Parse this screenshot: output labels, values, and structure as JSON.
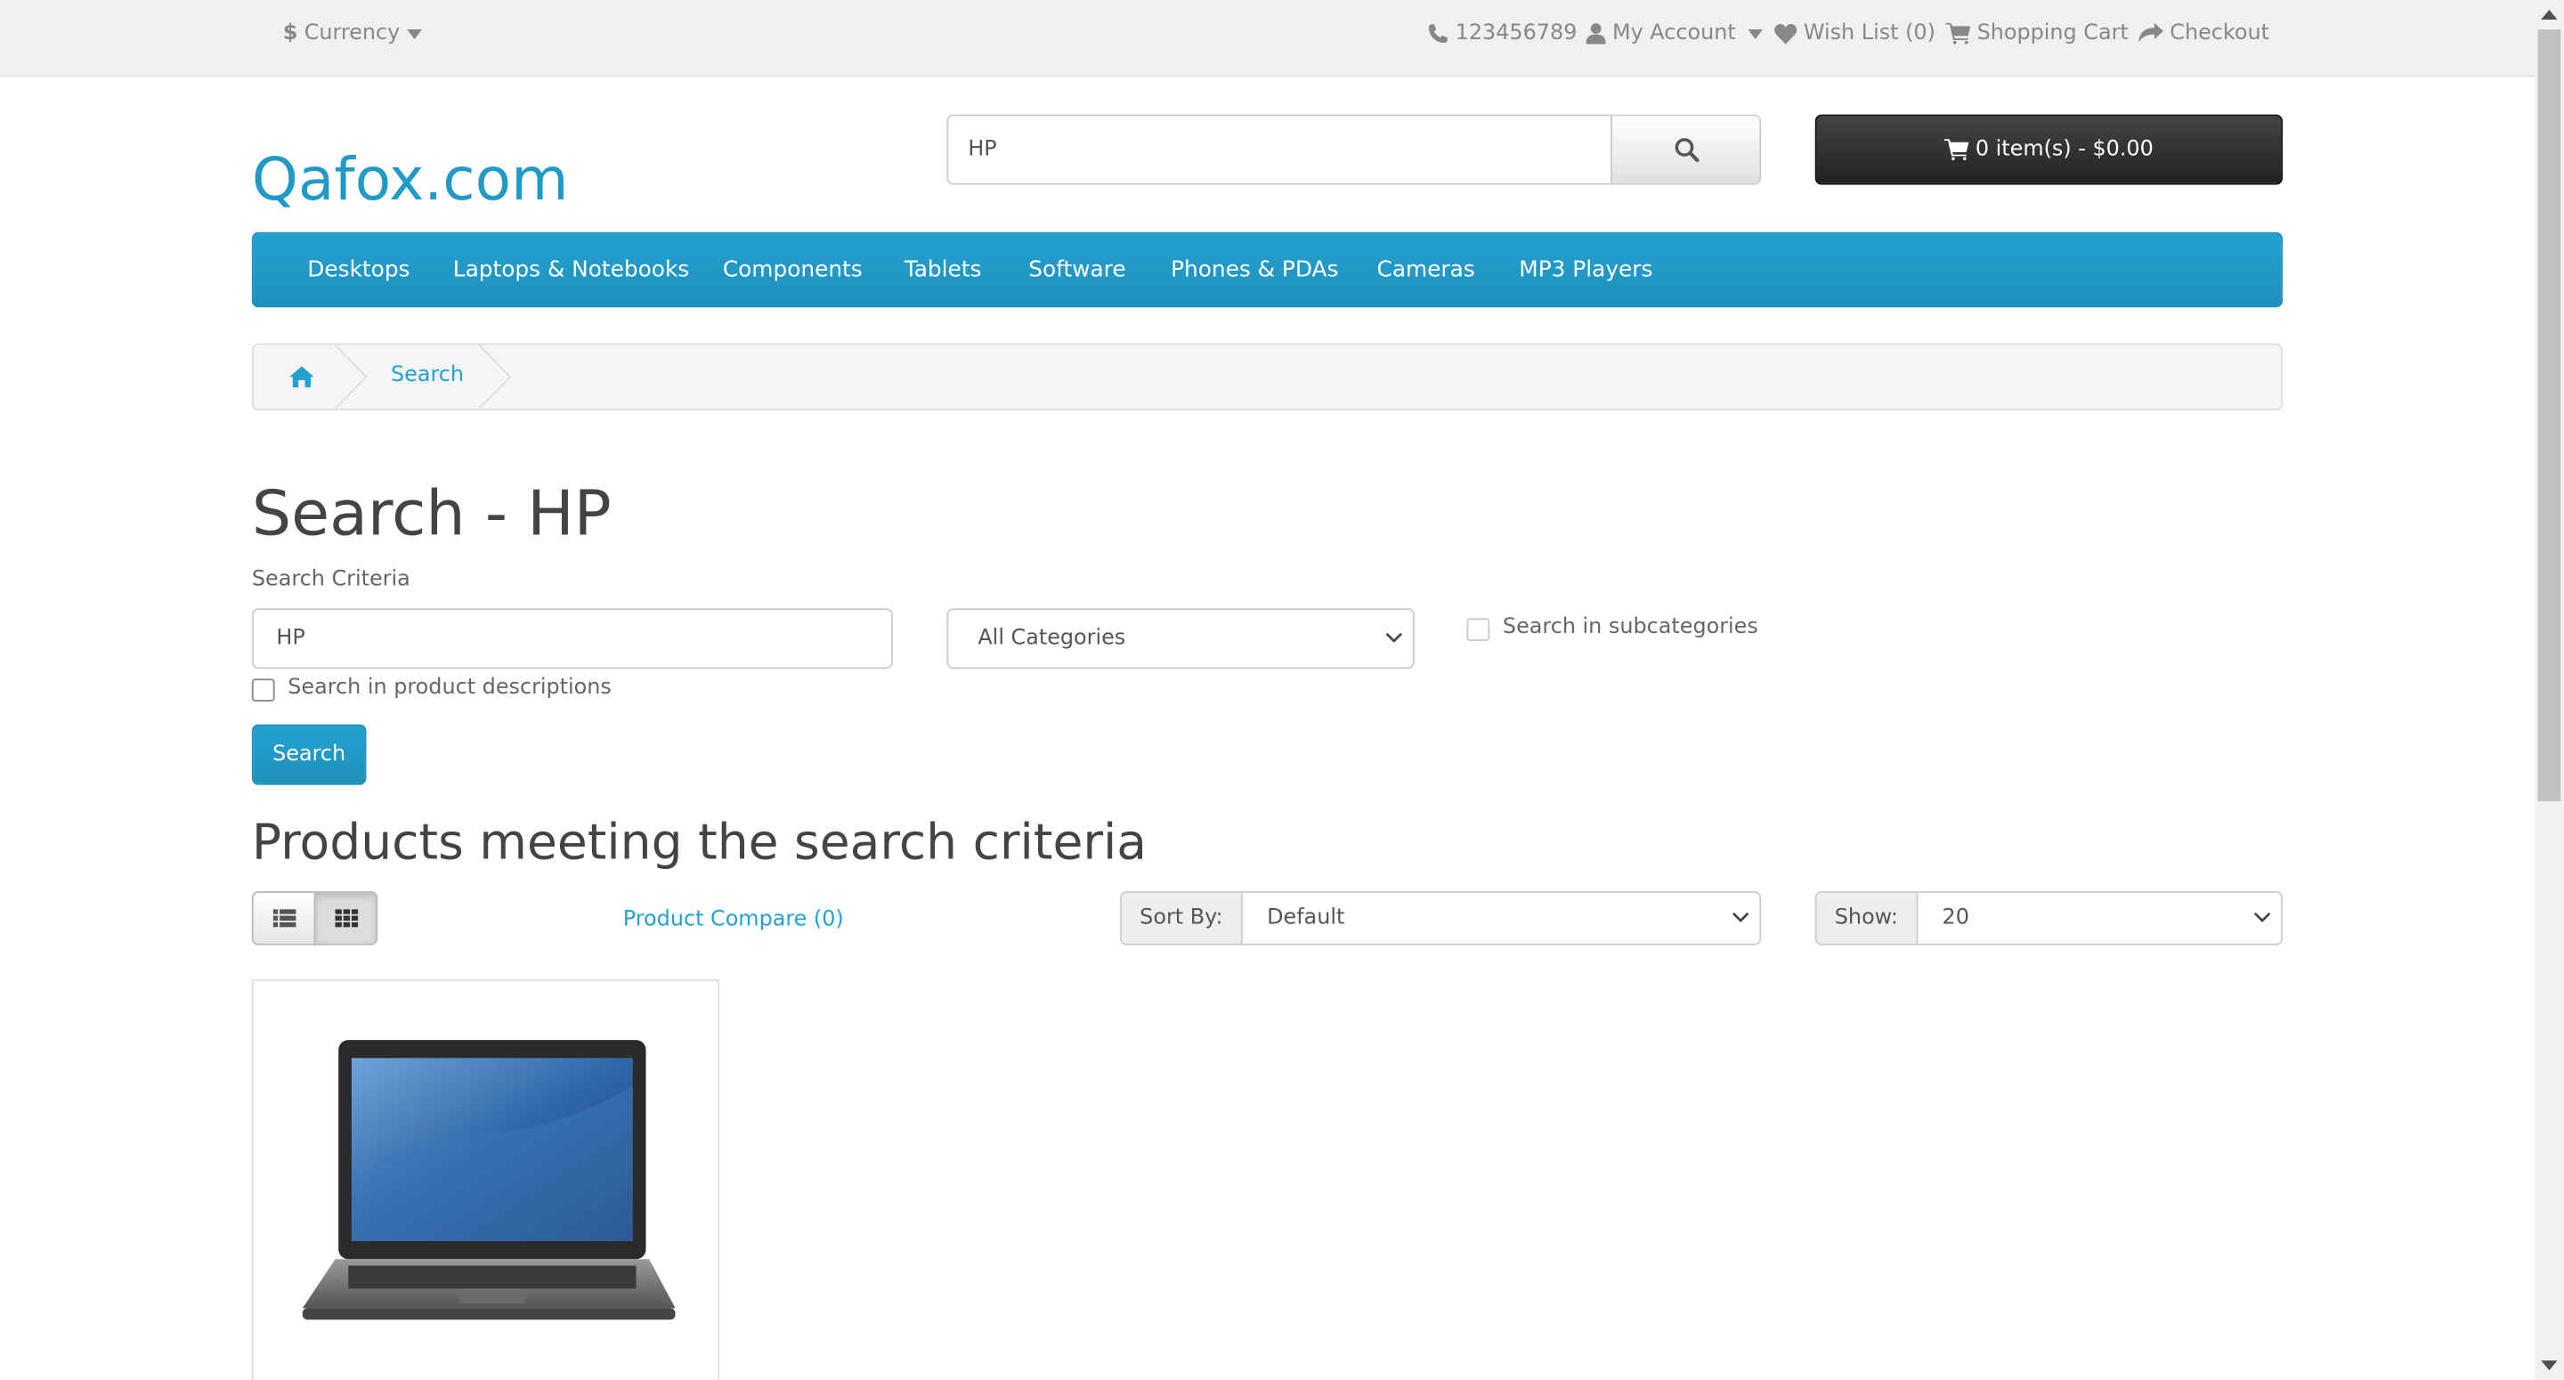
{
  "topbar": {
    "currency_label": "Currency",
    "currency_symbol": "$",
    "phone": "123456789",
    "my_account": "My Account",
    "wish_list": "Wish List (0)",
    "shopping_cart": "Shopping Cart",
    "checkout": "Checkout"
  },
  "header": {
    "logo": "Qafox.com",
    "search_value": "HP",
    "cart_label": "0 item(s) - $0.00"
  },
  "menu": {
    "items": [
      "Desktops",
      "Laptops & Notebooks",
      "Components",
      "Tablets",
      "Software",
      "Phones & PDAs",
      "Cameras",
      "MP3 Players"
    ]
  },
  "breadcrumb": {
    "current": "Search"
  },
  "search_page": {
    "title": "Search - HP",
    "criteria_label": "Search Criteria",
    "criteria_value": "HP",
    "category_selected": "All Categories",
    "subcategories_label": "Search in subcategories",
    "subcategories_checked": false,
    "descriptions_label": "Search in product descriptions",
    "descriptions_checked": false,
    "search_button": "Search"
  },
  "results": {
    "heading": "Products meeting the search criteria",
    "product_compare": "Product Compare (0)",
    "sort_label": "Sort By:",
    "sort_value": "Default",
    "show_label": "Show:",
    "show_value": "20"
  },
  "colors": {
    "accent": "#229ac8",
    "cart_dark": "#303030"
  }
}
